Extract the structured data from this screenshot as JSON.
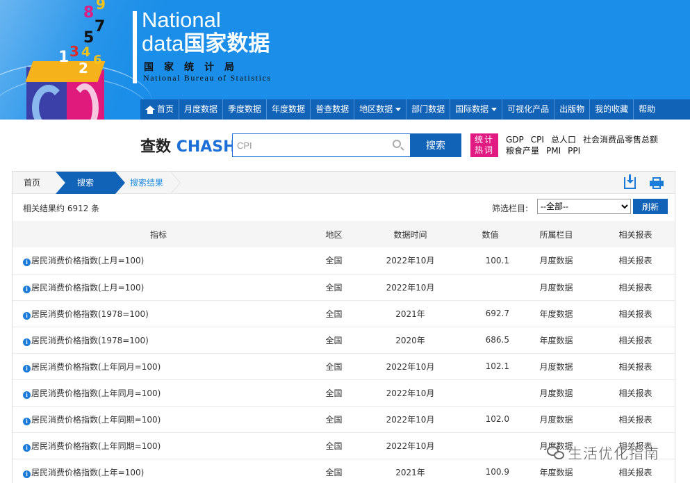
{
  "logo": {
    "title_line1": "National",
    "title_line2_en": "data",
    "title_line2_cn": "国家数据",
    "subtitle_cn": "国家统计局",
    "subtitle_en": "National Bureau of Statistics",
    "cube_numbers": [
      "1",
      "2",
      "3",
      "4",
      "5",
      "6",
      "7",
      "8",
      "9"
    ]
  },
  "nav": {
    "items": [
      {
        "label": "首页",
        "icon": "home-icon"
      },
      {
        "label": "月度数据"
      },
      {
        "label": "季度数据"
      },
      {
        "label": "年度数据"
      },
      {
        "label": "普查数据"
      },
      {
        "label": "地区数据",
        "dropdown": true
      },
      {
        "label": "部门数据"
      },
      {
        "label": "国际数据",
        "dropdown": true
      },
      {
        "label": "可视化产品"
      },
      {
        "label": "出版物"
      },
      {
        "label": "我的收藏"
      },
      {
        "label": "帮助"
      }
    ]
  },
  "search": {
    "logo_cn": "查数",
    "logo_en": "CHASHU",
    "query": "CPI",
    "button_label": "搜索",
    "hot_badge_line1": "统计",
    "hot_badge_line2": "热词",
    "hot_words": [
      "GDP",
      "CPI",
      "总人口",
      "社会消费品零售总额",
      "粮食产量",
      "PMI",
      "PPI"
    ]
  },
  "breadcrumb": {
    "home": "首页",
    "search": "搜索",
    "result": "搜索结果"
  },
  "results": {
    "count_text": "相关结果约 6912 条",
    "filter_label": "筛选栏目:",
    "filter_value": "--全部--",
    "refresh_label": "刷新"
  },
  "table": {
    "headers": {
      "name": "指标",
      "region": "地区",
      "time": "数据时间",
      "value": "数值",
      "column": "所属栏目",
      "related": "相关报表"
    },
    "rows": [
      {
        "name": "居民消费价格指数(上月=100)",
        "region": "全国",
        "time": "2022年10月",
        "value": "100.1",
        "column": "月度数据",
        "related": "相关报表"
      },
      {
        "name": "居民消费价格指数(上月=100)",
        "region": "全国",
        "time": "2022年10月",
        "value": "",
        "column": "月度数据",
        "related": "相关报表"
      },
      {
        "name": "居民消费价格指数(1978=100)",
        "region": "全国",
        "time": "2021年",
        "value": "692.7",
        "column": "年度数据",
        "related": "相关报表"
      },
      {
        "name": "居民消费价格指数(1978=100)",
        "region": "全国",
        "time": "2020年",
        "value": "686.5",
        "column": "年度数据",
        "related": "相关报表"
      },
      {
        "name": "居民消费价格指数(上年同月=100)",
        "region": "全国",
        "time": "2022年10月",
        "value": "102.1",
        "column": "月度数据",
        "related": "相关报表"
      },
      {
        "name": "居民消费价格指数(上年同月=100)",
        "region": "全国",
        "time": "2022年10月",
        "value": "",
        "column": "月度数据",
        "related": "相关报表"
      },
      {
        "name": "居民消费价格指数(上年同期=100)",
        "region": "全国",
        "time": "2022年10月",
        "value": "102.0",
        "column": "月度数据",
        "related": "相关报表"
      },
      {
        "name": "居民消费价格指数(上年同期=100)",
        "region": "全国",
        "time": "2022年10月",
        "value": "",
        "column": "月度数据",
        "related": "相关报表"
      },
      {
        "name": "居民消费价格指数(上年=100)",
        "region": "全国",
        "time": "2021年",
        "value": "100.9",
        "column": "年度数据",
        "related": "相关报表"
      }
    ]
  },
  "watermark": "生活优化指南"
}
